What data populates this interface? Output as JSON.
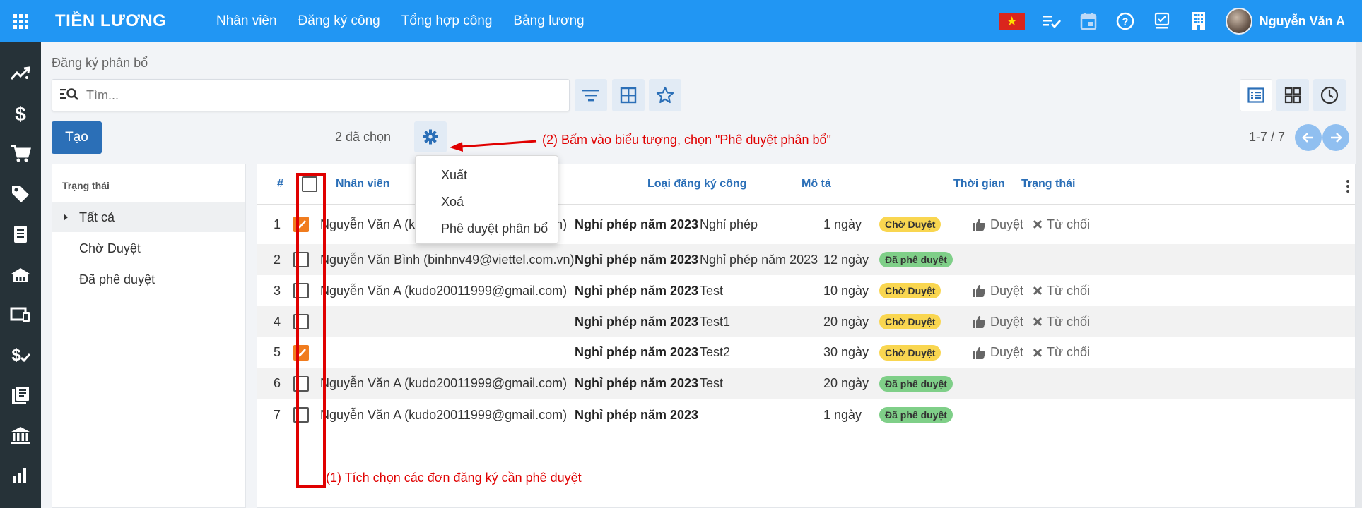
{
  "app": {
    "title": "TIỀN LƯƠNG"
  },
  "topnav": [
    {
      "label": "Nhân viên"
    },
    {
      "label": "Đăng ký công"
    },
    {
      "label": "Tổng hợp công"
    },
    {
      "label": "Bảng lương"
    }
  ],
  "user": {
    "name": "Nguyễn Văn A"
  },
  "sidebar_icons": [
    "trending-icon",
    "dollar-icon",
    "cart-icon",
    "tag-icon",
    "book-icon",
    "school-icon",
    "devices-icon",
    "payment-check-icon",
    "library-icon",
    "bank-icon",
    "bar-chart-icon"
  ],
  "breadcrumb": "Đăng ký phân bổ",
  "search": {
    "placeholder": "Tìm...",
    "value": ""
  },
  "toolbar": {
    "create_label": "Tạo",
    "selected_count": "2 đã chọn",
    "pager": "1-7 / 7"
  },
  "action_menu": {
    "items": [
      "Xuất",
      "Xoá",
      "Phê duyệt phân bổ"
    ]
  },
  "filter_panel": {
    "title": "Trạng thái",
    "items": [
      {
        "label": "Tất cả",
        "active": true
      },
      {
        "label": "Chờ Duyệt",
        "active": false
      },
      {
        "label": "Đã phê duyệt",
        "active": false
      }
    ]
  },
  "table": {
    "headers": {
      "index": "#",
      "employee": "Nhân viên",
      "type": "Loại đăng ký công",
      "description": "Mô tả",
      "duration": "Thời gian",
      "status": "Trạng thái"
    },
    "approve_label": "Duyệt",
    "reject_label": "Từ chối",
    "rows": [
      {
        "no": "1",
        "checked": true,
        "employee": "Nguyễn Văn A (kudo20011999@gmail.com)",
        "type": "Nghỉ phép năm 2023",
        "description": "Nghỉ phép",
        "duration": "1 ngày",
        "status": "Chờ Duyệt",
        "pending": true
      },
      {
        "no": "2",
        "checked": false,
        "employee": "Nguyễn Văn Bình (binhnv49@viettel.com.vn)",
        "type": "Nghỉ phép năm 2023",
        "description": "Nghỉ phép năm 2023",
        "duration": "12 ngày",
        "status": "Đã phê duyệt",
        "pending": false
      },
      {
        "no": "3",
        "checked": false,
        "employee": "Nguyễn Văn A (kudo20011999@gmail.com)",
        "type": "Nghỉ phép năm 2023",
        "description": "Test",
        "duration": "10 ngày",
        "status": "Chờ Duyệt",
        "pending": true
      },
      {
        "no": "4",
        "checked": false,
        "employee": "",
        "type": "Nghỉ phép năm 2023",
        "description": "Test1",
        "duration": "20 ngày",
        "status": "Chờ Duyệt",
        "pending": true
      },
      {
        "no": "5",
        "checked": true,
        "employee": "",
        "type": "Nghỉ phép năm 2023",
        "description": "Test2",
        "duration": "30 ngày",
        "status": "Chờ Duyệt",
        "pending": true
      },
      {
        "no": "6",
        "checked": false,
        "employee": "Nguyễn Văn A (kudo20011999@gmail.com)",
        "type": "Nghỉ phép năm 2023",
        "description": "Test",
        "duration": "20 ngày",
        "status": "Đã phê duyệt",
        "pending": false
      },
      {
        "no": "7",
        "checked": false,
        "employee": "Nguyễn Văn A (kudo20011999@gmail.com)",
        "type": "Nghỉ phép năm 2023",
        "description": "",
        "duration": "1 ngày",
        "status": "Đã phê duyệt",
        "pending": false
      }
    ]
  },
  "annotations": {
    "step1": "(1) Tích chọn các đơn đăng ký cần phê duyệt",
    "step2": "(2) Bấm vào biểu tượng, chọn \"Phê duyệt phân bổ\""
  },
  "colors": {
    "topbar": "#2196f3",
    "sidebar": "#263238",
    "primary_button": "#2b6fb7",
    "checkbox_checked": "#f07c1e",
    "pending_badge": "#f9d650",
    "approved_badge": "#7fcf88",
    "annotation": "#e00000"
  }
}
